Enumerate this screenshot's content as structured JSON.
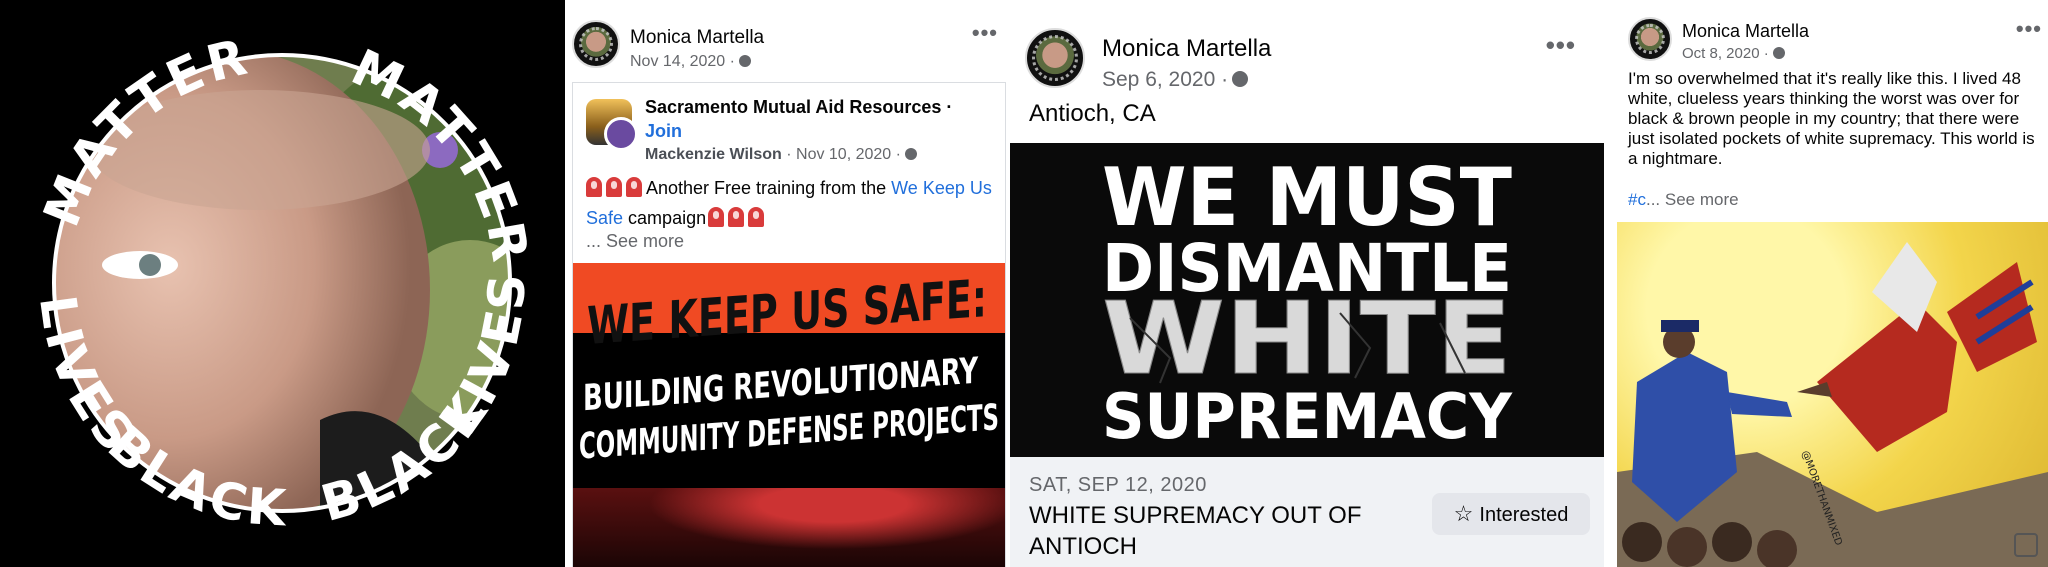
{
  "profile_picture": {
    "ring_text_top": "MATTER",
    "ring_text_top_right": "MATTER",
    "ring_text_left": "LIVES",
    "ring_text_right": "LIVES",
    "ring_text_bottom_left": "BLACK",
    "ring_text_bottom_right": "BLACK"
  },
  "post1": {
    "author": "Monica Martella",
    "date": "Nov 14, 2020 ·",
    "more_icon": "more-options-icon",
    "shared": {
      "group_name": "Sacramento Mutual Aid Resources ·",
      "join_label": "Join",
      "poster_name": "Mackenzie Wilson",
      "poster_date": "· Nov 10, 2020 ·",
      "text_before_link": "Another Free training from the",
      "link_text": "We Keep Us Safe",
      "text_after_link": "campaign",
      "see_more": "... See more",
      "image_line1": "WE KEEP US SAFE:",
      "image_line2": "BUILDING REVOLUTIONARY",
      "image_line3": "COMMUNITY DEFENSE PROJECTS"
    }
  },
  "post2": {
    "author": "Monica Martella",
    "date": "Sep 6, 2020 ·",
    "location": "Antioch, CA",
    "image_line1": "WE MUST",
    "image_line2": "DISMANTLE",
    "image_line3": "WHITE",
    "image_line4": "SUPREMACY",
    "event_date": "SAT, SEP 12, 2020",
    "event_title": "WHITE SUPREMACY OUT OF ANTIOCH",
    "interested_label": "Interested"
  },
  "post3": {
    "author": "Monica Martella",
    "date": "Oct 8, 2020 ·",
    "text": "I'm so overwhelmed that it's really like this. I lived 48 white, clueless years thinking the worst was over for black & brown people in my country; that there were just isolated pockets of white supremacy. This world is a nightmare.",
    "hashtag": "#c",
    "see_more": "... See more",
    "art_watermark": "@MORETHANMIXED"
  },
  "colors": {
    "link_blue": "#216fdb",
    "meta_gray": "#65676b",
    "poster_orange": "#f04a23",
    "event_panel_bg": "#f0f2f5"
  }
}
